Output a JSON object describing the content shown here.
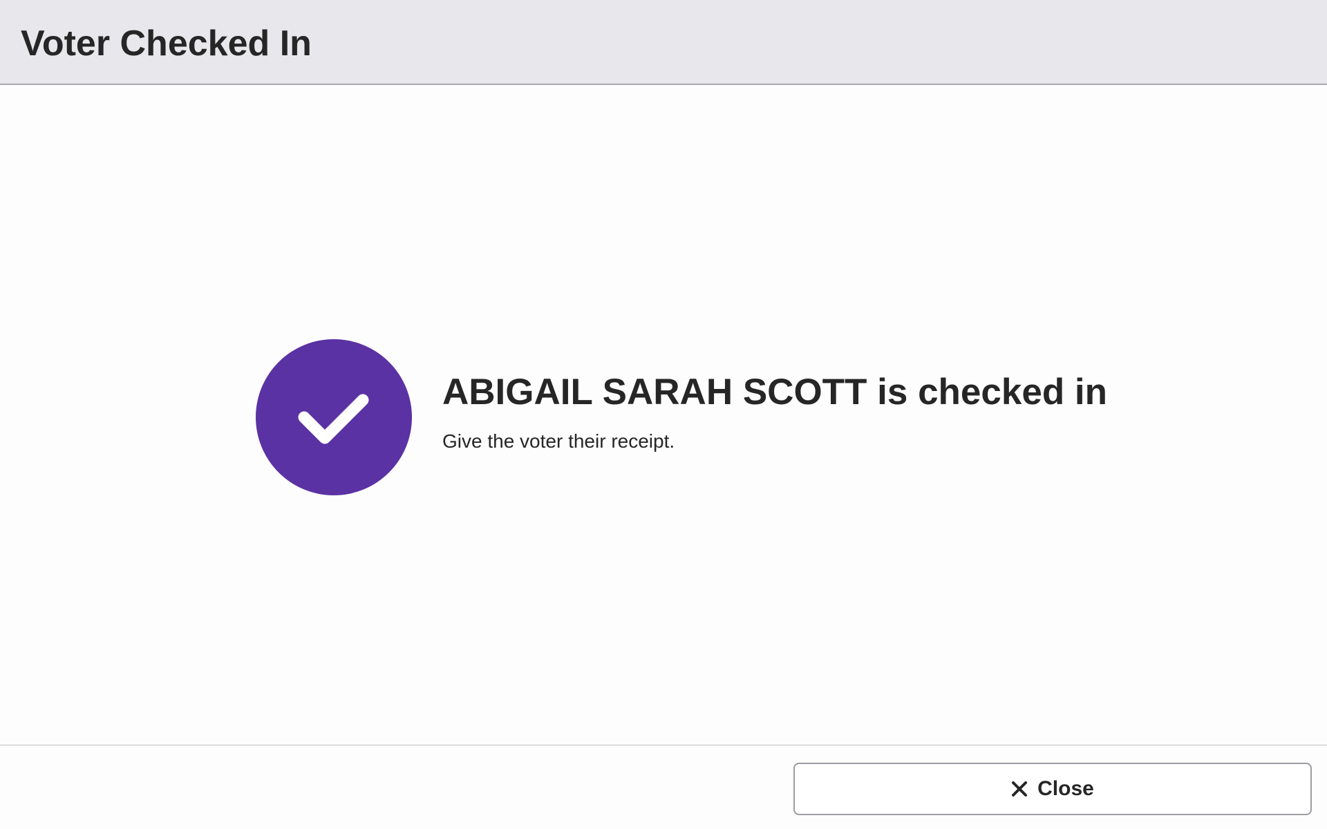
{
  "header": {
    "title": "Voter Checked In"
  },
  "main": {
    "icon": "check-circle-icon",
    "heading": "ABIGAIL SARAH SCOTT is checked in",
    "message": "Give the voter their receipt."
  },
  "footer": {
    "close_label": "Close",
    "close_icon": "close-icon"
  },
  "colors": {
    "accent": "#5b32a3",
    "header_bg": "#e8e8ec",
    "text": "#262626",
    "background": "#fdfdfd"
  }
}
